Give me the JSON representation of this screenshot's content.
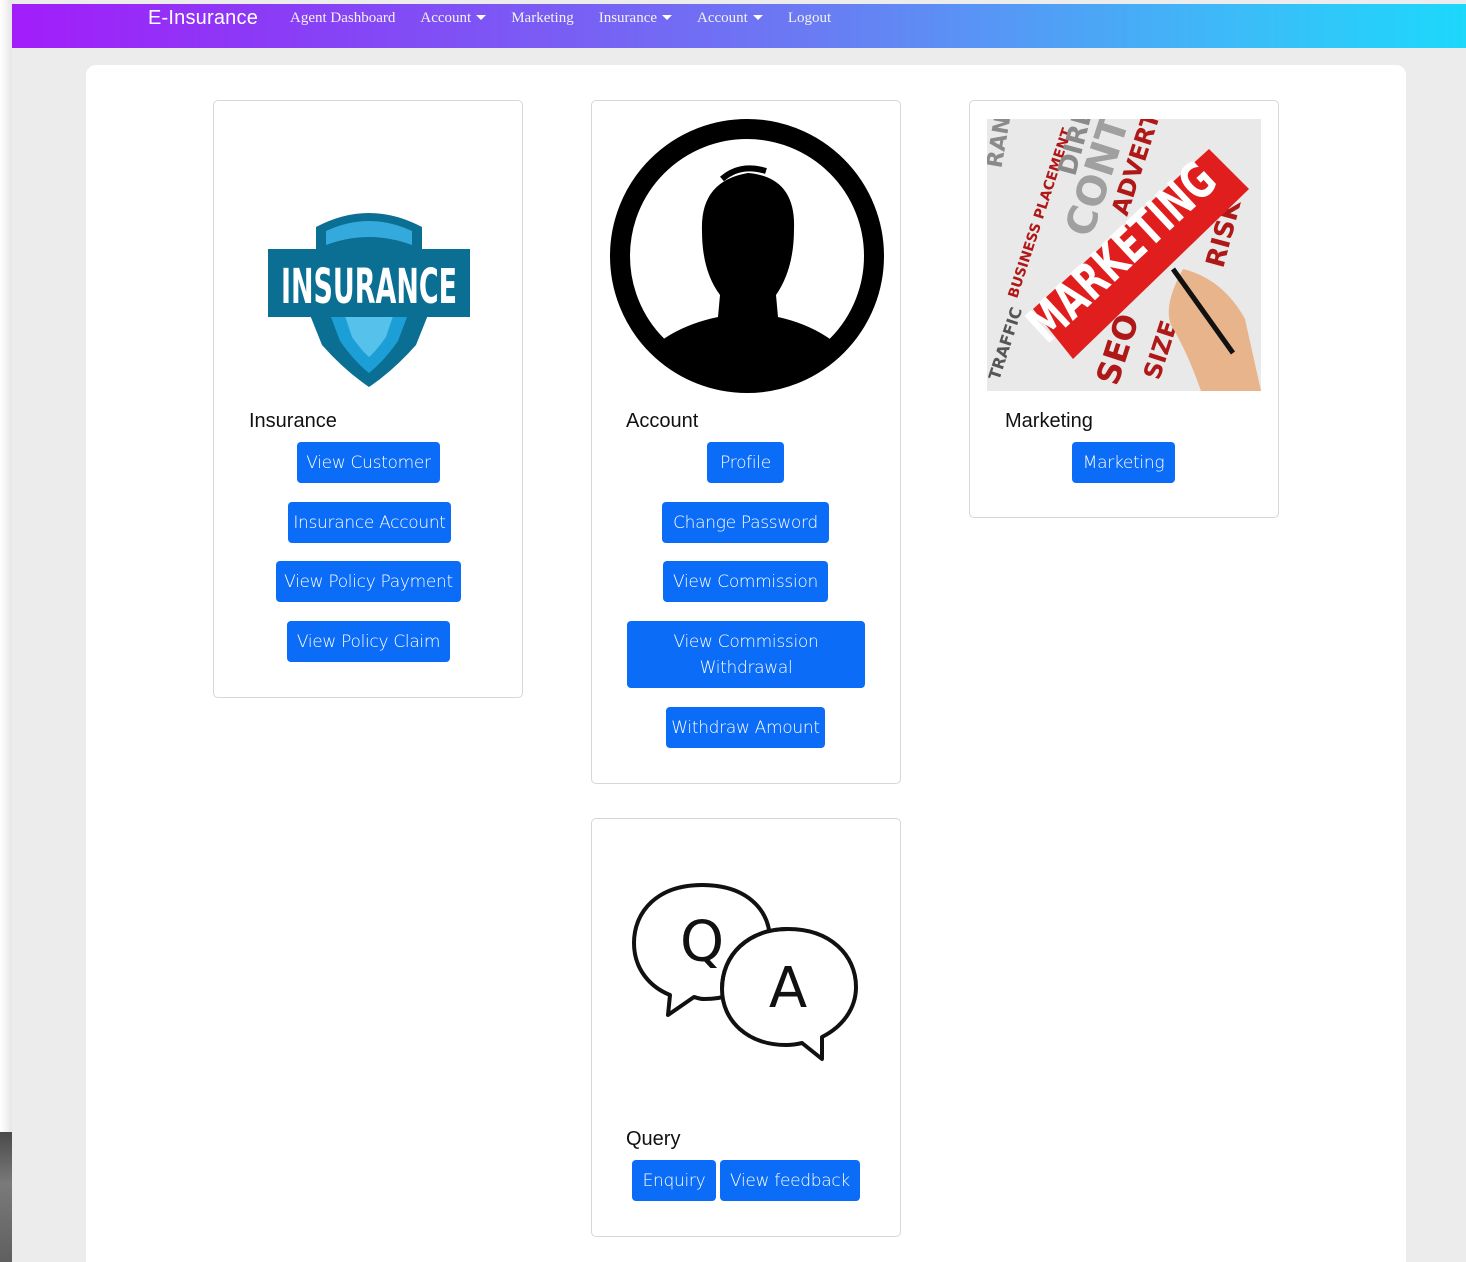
{
  "navbar": {
    "brand": "E-Insurance",
    "items": [
      {
        "label": "Agent Dashboard",
        "dropdown": false
      },
      {
        "label": "Account",
        "dropdown": true
      },
      {
        "label": "Marketing",
        "dropdown": false
      },
      {
        "label": "Insurance",
        "dropdown": true
      },
      {
        "label": "Account",
        "dropdown": true
      },
      {
        "label": "Logout",
        "dropdown": false
      }
    ]
  },
  "cards": {
    "insurance": {
      "image_text": "INSURANCE",
      "title": "Insurance",
      "buttons": [
        "View Customer",
        "Insurance Account",
        "View Policy Payment",
        "View Policy Claim"
      ]
    },
    "account": {
      "title": "Account",
      "buttons": [
        "Profile",
        "Change Password",
        "View Commission",
        "View Commission Withdrawal",
        "Withdraw Amount"
      ]
    },
    "marketing": {
      "image_text": "MARKETING",
      "title": "Marketing",
      "buttons": [
        "Marketing"
      ]
    },
    "query": {
      "q_letter": "Q",
      "a_letter": "A",
      "title": "Query",
      "buttons": [
        "Enquiry",
        "View feedback"
      ]
    }
  },
  "colors": {
    "primary_button": "#0b6cf7",
    "navbar_start": "#a31dfa",
    "navbar_end": "#1cd8fb",
    "insurance_shield": "#0b6f94"
  },
  "icons": [
    "insurance-shield-icon",
    "user-avatar-icon",
    "marketing-collage-image",
    "qa-speech-bubbles-icon",
    "caret-down-icon"
  ]
}
